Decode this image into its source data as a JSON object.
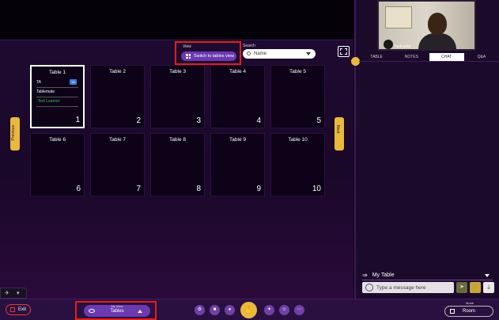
{
  "view": {
    "label": "View",
    "button": "Switch to tables view"
  },
  "search": {
    "label": "Search",
    "value": "Name"
  },
  "tables": [
    {
      "title": "Table 1",
      "number": "1",
      "seats": [
        "TA",
        "Tablemate",
        "Test Learner"
      ],
      "badge": "TA"
    },
    {
      "title": "Table 2",
      "number": "2"
    },
    {
      "title": "Table 3",
      "number": "3"
    },
    {
      "title": "Table 4",
      "number": "4"
    },
    {
      "title": "Table 5",
      "number": "5"
    },
    {
      "title": "Table 6",
      "number": "6"
    },
    {
      "title": "Table 7",
      "number": "7"
    },
    {
      "title": "Table 8",
      "number": "8"
    },
    {
      "title": "Table 9",
      "number": "9"
    },
    {
      "title": "Table 10",
      "number": "10"
    }
  ],
  "nav": {
    "previous": "Previous",
    "next": "Next"
  },
  "sidebar": {
    "video_name": "Instructor",
    "tabs": [
      "TABLE",
      "NOTES",
      "CHAT",
      "Q&A"
    ],
    "active_tab": "CHAT",
    "chat_scope": "My Table",
    "chat_placeholder": "Type a message here",
    "chat_scope_arrow": "⇒"
  },
  "bottom": {
    "exit": "Exit",
    "my_view_label": "My View",
    "my_view_value": "Tables",
    "mode_label": "Mode",
    "mode_value": "Room"
  },
  "colors": {
    "accent": "#6b3ab0",
    "highlight": "#e0201a",
    "gold": "#e9b93d"
  }
}
